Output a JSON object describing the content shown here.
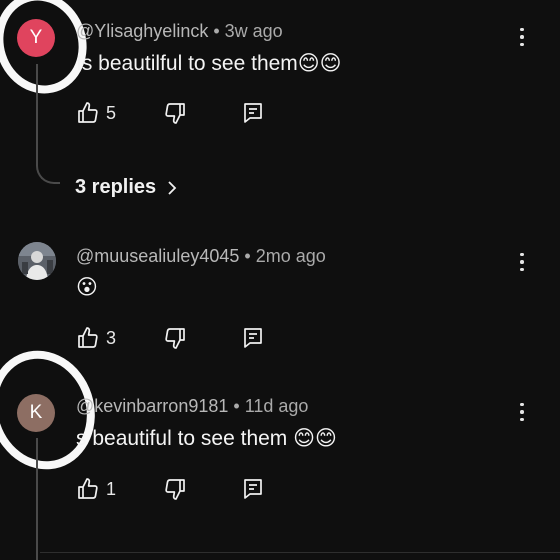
{
  "comments": [
    {
      "avatar_letter": "Y",
      "handle": "@Ylisaghyelinck",
      "age": "3w ago",
      "text": "Is beautilful to see them😊😊",
      "likes": "5"
    },
    {
      "avatar_letter": "",
      "handle": "@muusealiuley4045",
      "age": "2mo ago",
      "text": "😮",
      "likes": "3"
    },
    {
      "avatar_letter": "K",
      "handle": "@kevinbarron9181",
      "age": "11d ago",
      "text": "s beautiful to see them 😊😊",
      "likes": "1"
    }
  ],
  "replies_label": "3 replies",
  "separator": " • ",
  "icons": {
    "like": "thumb-up-icon",
    "dislike": "thumb-down-icon",
    "reply": "reply-icon",
    "more": "more-vert-icon",
    "chevron": "chevron-right-icon"
  },
  "colors": {
    "background": "#0f0f0f",
    "avatar_y": "#e0445e",
    "avatar_k": "#8d6e63",
    "annotation_circle": "#ffffff"
  }
}
